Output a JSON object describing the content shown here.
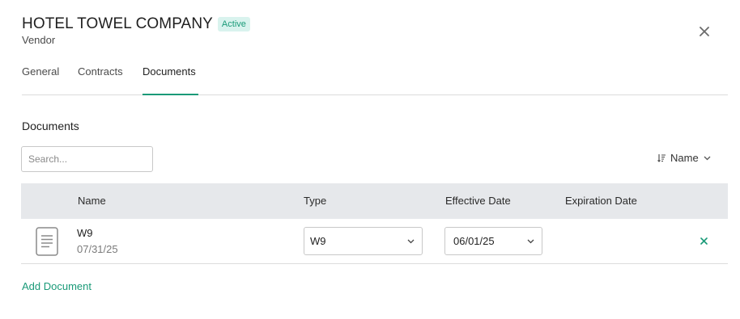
{
  "header": {
    "title": "HOTEL TOWEL COMPANY",
    "status_badge": "Active",
    "subtitle": "Vendor"
  },
  "tabs": [
    {
      "label": "General",
      "active": false
    },
    {
      "label": "Contracts",
      "active": false
    },
    {
      "label": "Documents",
      "active": true
    }
  ],
  "documents": {
    "section_title": "Documents",
    "search_placeholder": "Search...",
    "sort_label": "Name",
    "columns": [
      "Name",
      "Type",
      "Effective Date",
      "Expiration Date"
    ],
    "rows": [
      {
        "name": "W9",
        "date": "07/31/25",
        "type": "W9",
        "effective_date": "06/01/25",
        "expiration_date": ""
      }
    ],
    "add_label": "Add Document"
  },
  "icons": {
    "close": "close-icon",
    "sort": "sort-icon",
    "chevron": "chevron-down-icon",
    "document": "document-icon",
    "remove": "remove-icon"
  },
  "colors": {
    "accent": "#1a9a78",
    "badge_bg": "#d9f3ee",
    "table_header_bg": "#e6e8eb"
  }
}
